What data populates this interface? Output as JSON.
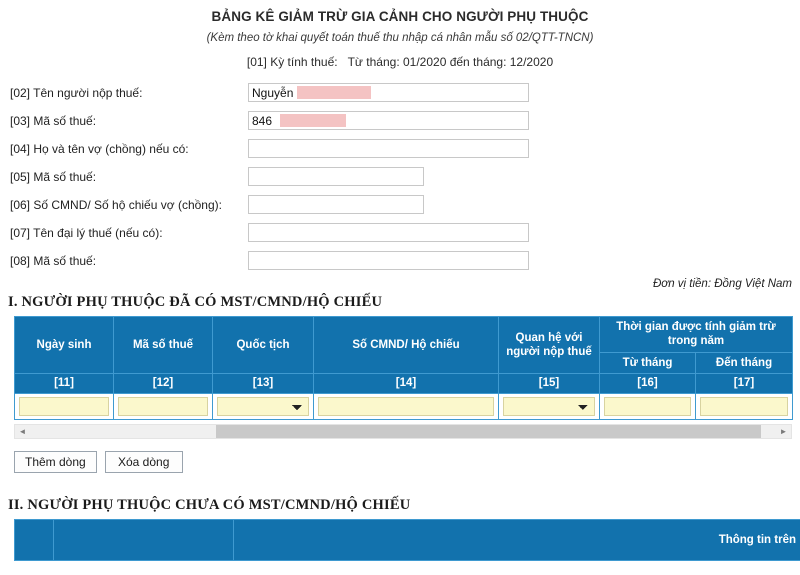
{
  "header": {
    "title": "BẢNG KÊ GIẢM TRỪ GIA CẢNH CHO NGƯỜI PHỤ THUỘC",
    "subtitle": "(Kèm theo tờ khai quyết toán thuế thu nhập cá nhân mẫu số 02/QTT-TNCN)",
    "period_code": "[01] Kỳ tính thuế:",
    "period_value": "Từ tháng: 01/2020 đến tháng: 12/2020"
  },
  "form": {
    "fields": [
      {
        "label": "[02] Tên người nộp thuế:",
        "value": "Nguyễn",
        "width": "wide",
        "redacted": "name"
      },
      {
        "label": "[03] Mã số thuế:",
        "value": "846",
        "width": "wide",
        "redacted": "mst"
      },
      {
        "label": "[04] Họ và tên vợ (chồng) nếu có:",
        "value": "",
        "width": "wide",
        "redacted": ""
      },
      {
        "label": "[05] Mã số thuế:",
        "value": "",
        "width": "narrow",
        "redacted": ""
      },
      {
        "label": "[06] Số CMND/ Số hộ chiếu vợ (chồng):",
        "value": "",
        "width": "narrow",
        "redacted": ""
      },
      {
        "label": "[07] Tên đại lý thuế (nếu có):",
        "value": "",
        "width": "wide",
        "redacted": ""
      },
      {
        "label": "[08] Mã số thuế:",
        "value": "",
        "width": "wide",
        "redacted": ""
      }
    ]
  },
  "currency_note": "Đơn vị tiền: Đồng Việt Nam",
  "section_one": {
    "heading": "I. NGƯỜI PHỤ THUỘC ĐÃ CÓ MST/CMND/HỘ CHIẾU",
    "columns": [
      {
        "label": "Ngày sinh",
        "code": "[11]",
        "type": "text"
      },
      {
        "label": "Mã số thuế",
        "code": "[12]",
        "type": "text"
      },
      {
        "label": "Quốc tịch",
        "code": "[13]",
        "type": "select"
      },
      {
        "label": "Số CMND/ Hộ chiếu",
        "code": "[14]",
        "type": "text"
      },
      {
        "label": "Quan hệ với người nộp thuế",
        "code": "[15]",
        "type": "select"
      }
    ],
    "group_header": "Thời gian được tính giảm trừ trong năm",
    "group_columns": [
      {
        "label": "Từ tháng",
        "code": "[16]",
        "type": "text"
      },
      {
        "label": "Đến tháng",
        "code": "[17]",
        "type": "text"
      }
    ],
    "row_values": [
      "",
      "",
      "",
      "",
      "",
      "",
      ""
    ],
    "scrollbar": {
      "left_arrow": "◄",
      "right_arrow": "►"
    },
    "buttons": {
      "add_row": "Thêm dòng",
      "delete_row": "Xóa dòng"
    }
  },
  "section_two": {
    "heading": "II. NGƯỜI PHỤ THUỘC CHƯA CÓ MST/CMND/HỘ CHIẾU",
    "columns": [
      {
        "label": ""
      },
      {
        "label": ""
      },
      {
        "label": "Thông tin trên"
      }
    ]
  },
  "colors": {
    "header_blue": "#1272ad",
    "grid_line": "#3f9ad0",
    "input_yellow": "#fbf8cc",
    "redaction": "#f2b6b6"
  }
}
